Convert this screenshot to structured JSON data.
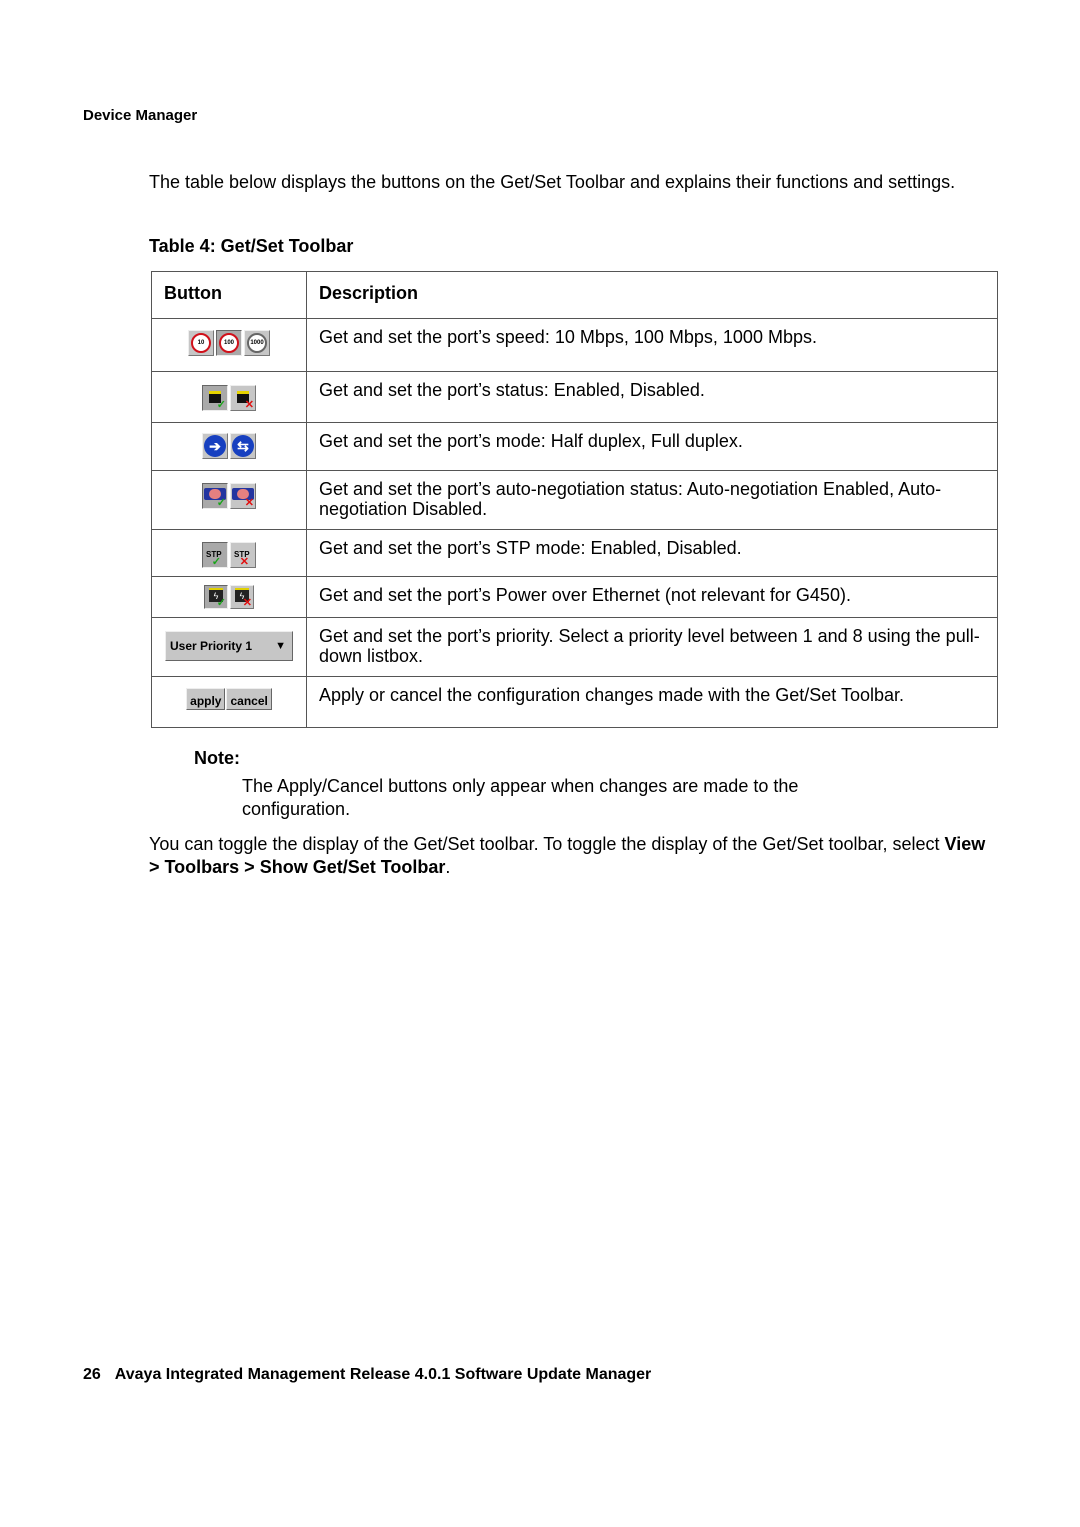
{
  "running_head": "Device Manager",
  "intro": "The table below displays the buttons on the Get/Set Toolbar and explains their functions and settings.",
  "table": {
    "caption": "Table 4: Get/Set Toolbar",
    "headers": [
      "Button",
      "Description"
    ],
    "rows": [
      {
        "icons": [
          "speed-10-icon",
          "speed-100-icon",
          "speed-1000-icon"
        ],
        "icon_labels": [
          "10",
          "100",
          "1000"
        ],
        "description": "Get and set the port’s speed: 10 Mbps, 100 Mbps, 1000 Mbps."
      },
      {
        "icons": [
          "port-enabled-icon",
          "port-disabled-icon"
        ],
        "description": "Get and set the port’s status: Enabled, Disabled."
      },
      {
        "icons": [
          "half-duplex-icon",
          "full-duplex-icon"
        ],
        "icon_labels": [
          "➔",
          "⇆"
        ],
        "description": "Get and set the port’s mode: Half duplex, Full duplex."
      },
      {
        "icons": [
          "autoneg-enabled-icon",
          "autoneg-disabled-icon"
        ],
        "description": "Get and set the port’s auto-negotiation status: Auto-negotiation Enabled, Auto-negotiation Disabled."
      },
      {
        "icons": [
          "stp-enabled-icon",
          "stp-disabled-icon"
        ],
        "icon_labels": [
          "STP",
          "STP"
        ],
        "description": "Get and set the port’s STP mode: Enabled, Disabled."
      },
      {
        "icons": [
          "poe-enabled-icon",
          "poe-disabled-icon"
        ],
        "description": "Get and set the port’s Power over Ethernet (not relevant for G450)."
      },
      {
        "icons": [
          "user-priority-select"
        ],
        "select_value": "User Priority 1",
        "description": "Get and set the port’s priority. Select a priority level between 1 and 8 using the pull-down listbox."
      },
      {
        "icons": [
          "apply-button",
          "cancel-button"
        ],
        "icon_labels": [
          "apply",
          "cancel"
        ],
        "description": "Apply or cancel the configuration changes made with the Get/Set Toolbar."
      }
    ]
  },
  "note": {
    "label": "Note:",
    "text": "The Apply/Cancel buttons only appear when changes are made to the configuration."
  },
  "toggle": {
    "text_before": "You can toggle the display of the Get/Set toolbar. To toggle the display of the Get/Set toolbar, select ",
    "menu_path": "View > Toolbars > Show Get/Set Toolbar",
    "text_after": "."
  },
  "footer": {
    "page_number": "26",
    "title": "Avaya Integrated Management Release 4.0.1 Software Update Manager"
  },
  "colors": {
    "text": "#000000",
    "table_border": "#555555",
    "button_face": "#c6c6c6",
    "speed_ring": "#d0101a",
    "duplex_blue": "#1740c0",
    "check_green": "#1aa51a",
    "cross_red": "#e01010"
  }
}
